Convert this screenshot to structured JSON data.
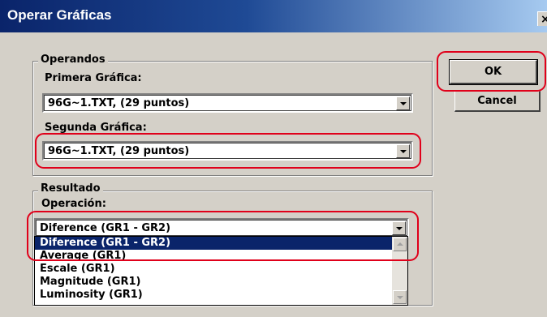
{
  "window": {
    "title": "Operar Gráficas",
    "close_glyph": "×"
  },
  "operandos": {
    "legend": "Operandos",
    "primera_label": "Primera Gráfica:",
    "primera_value": "96G~1.TXT, (29 puntos)",
    "segunda_label": "Segunda Gráfica:",
    "segunda_value": "96G~1.TXT, (29 puntos)"
  },
  "resultado": {
    "legend": "Resultado",
    "operacion_label": "Operación:",
    "operacion_value": "Diference (GR1 - GR2)",
    "options": [
      "Diference (GR1 - GR2)",
      "Average (GR1)",
      "Escale (GR1)",
      "Magnitude (GR1)",
      "Luminosity (GR1)"
    ],
    "selected_index": 0
  },
  "buttons": {
    "ok": "OK",
    "cancel": "Cancel"
  },
  "colors": {
    "highlight": "#e0001a",
    "selection": "#0a246a",
    "titlebar": "#0a246a"
  }
}
